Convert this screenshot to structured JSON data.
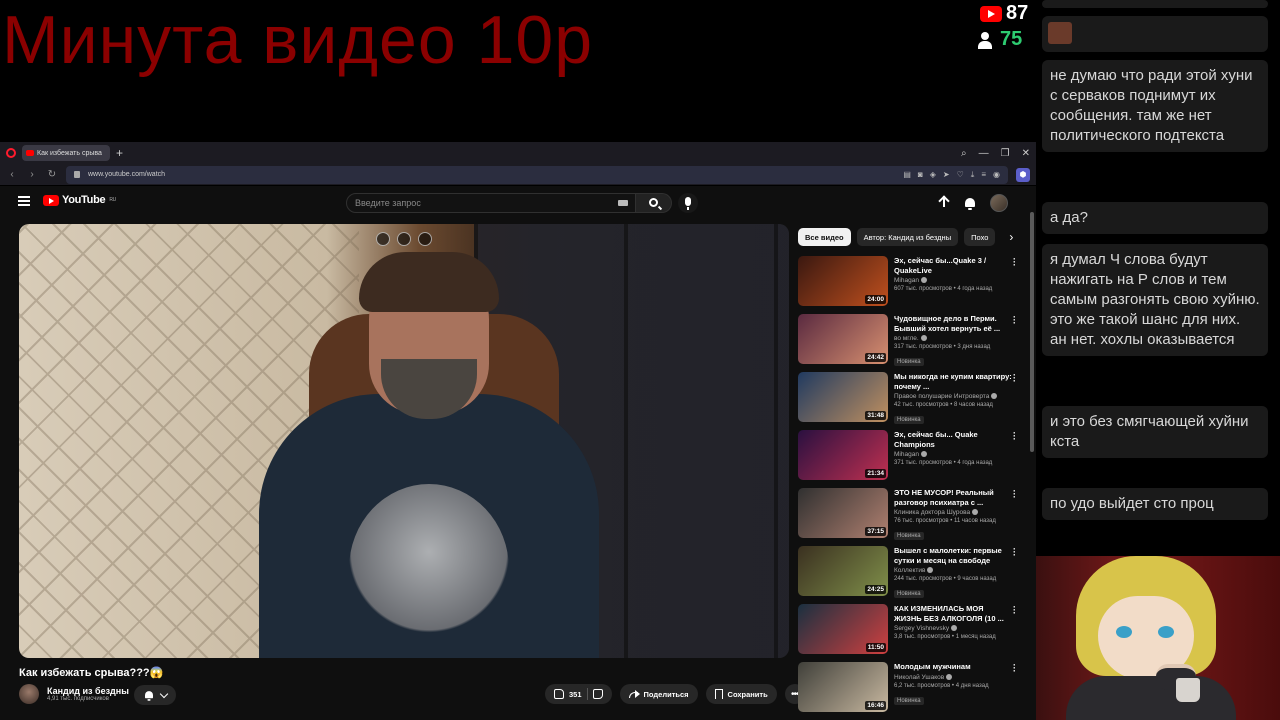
{
  "overlay": {
    "title": "Минута видео 10р",
    "youtube_count": "87",
    "twitch_count": "75"
  },
  "browser": {
    "tab_title": "Как избежать срыва",
    "url": "www.youtube.com/watch"
  },
  "youtube": {
    "brand": "YouTube",
    "brand_region": "RU",
    "search_placeholder": "Введите запрос",
    "video": {
      "title": "Как избежать срыва???😱",
      "channel": "Кандид из бездны",
      "subscribers": "4,91 тыс. подписчиков",
      "likes": "351",
      "share_label": "Поделиться",
      "save_label": "Сохранить"
    },
    "chips": [
      "Все видео",
      "Автор: Кандид из бездны",
      "Похо"
    ],
    "recommendations": [
      {
        "title": "Эх, сейчас бы...Quake 3 / QuakeLive",
        "channel": "Mihagan",
        "meta": "607 тыс. просмотров • 4 года назад",
        "duration": "24:00",
        "badge": "",
        "thumb": [
          "#3a1810",
          "#c0501e"
        ]
      },
      {
        "title": "Чудовищное дело в Перми. Бывший хотел вернуть её ...",
        "channel": "во мгле.",
        "meta": "317 тыс. просмотров • 3 дня назад",
        "duration": "24:42",
        "badge": "Новинка",
        "thumb": [
          "#5a2a40",
          "#d89070"
        ]
      },
      {
        "title": "Мы никогда не купим квартиру: почему ...",
        "channel": "Правое полушарие Интроверта",
        "meta": "42 тыс. просмотров • 8 часов назад",
        "duration": "31:48",
        "badge": "Новинка",
        "thumb": [
          "#203a60",
          "#c09060"
        ]
      },
      {
        "title": "Эх, сейчас бы... Quake Champions",
        "channel": "Mihagan",
        "meta": "371 тыс. просмотров • 4 года назад",
        "duration": "21:34",
        "badge": "",
        "thumb": [
          "#2a1040",
          "#c03050"
        ]
      },
      {
        "title": "ЭТО НЕ МУСОР! Реальный разговор психиатра с ...",
        "channel": "Клиника доктора Шурова",
        "meta": "76 тыс. просмотров • 11 часов назад",
        "duration": "37:15",
        "badge": "Новинка",
        "thumb": [
          "#303030",
          "#b08070"
        ]
      },
      {
        "title": "Вышел с малолетки: первые сутки и месяц на свободе",
        "channel": "Коллектив",
        "meta": "244 тыс. просмотров • 9 часов назад",
        "duration": "24:25",
        "badge": "Новинка",
        "thumb": [
          "#3a3020",
          "#80904a"
        ]
      },
      {
        "title": "КАК ИЗМЕНИЛАСЬ МОЯ ЖИЗНЬ БЕЗ АЛКОГОЛЯ (10 ...",
        "channel": "Sergey Vishnevsky",
        "meta": "3,8 тыс. просмотров • 1 месяц назад",
        "duration": "11:50",
        "badge": "",
        "thumb": [
          "#1a3040",
          "#d04040"
        ]
      },
      {
        "title": "Молодым мужчинам",
        "channel": "Николай Ушаков",
        "meta": "6,2 тыс. просмотров • 4 дня назад",
        "duration": "16:46",
        "badge": "Новинка",
        "thumb": [
          "#40403a",
          "#c8b8a0"
        ]
      }
    ]
  },
  "chat": {
    "messages": [
      {
        "text": "не думаю что ради этой хуни с серваков поднимут их сообщения. там же нет политического подтекста"
      },
      {
        "text": "а да?"
      },
      {
        "text": "я думал Ч слова будут нажигать на Р слов и тем самым разгонять свою хуйню. это же такой шанс для них. ан нет. хохлы оказывается"
      },
      {
        "text": "и это без смягчающей хуйни кста"
      },
      {
        "text": "по удо выйдет сто проц"
      }
    ]
  },
  "colors": {
    "overlay_title": "#8b0000",
    "youtube_red": "#ff0000",
    "twitch_green": "#2ecc71",
    "page_bg": "#0f0f0f"
  }
}
